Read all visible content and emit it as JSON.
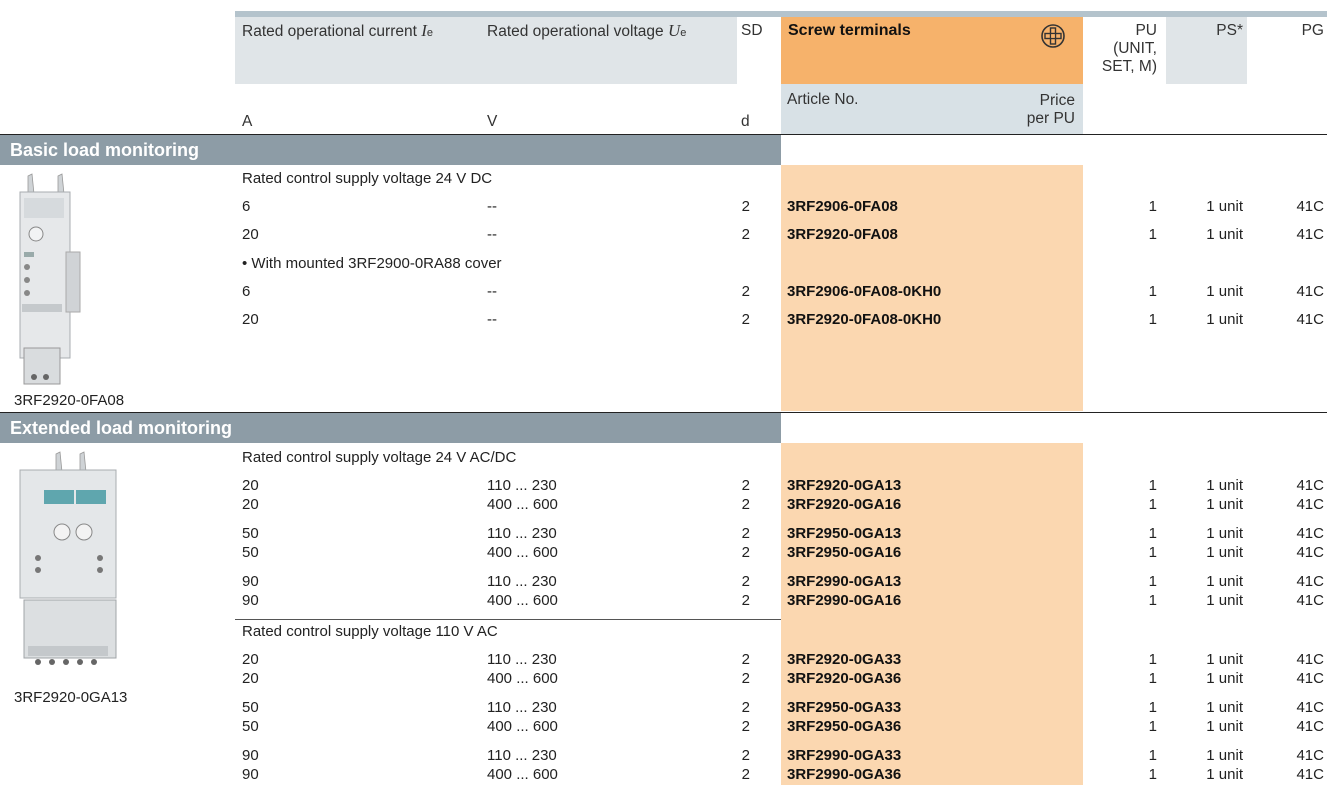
{
  "header": {
    "current_label": "Rated operational current",
    "current_symbol": "I",
    "current_sub": "e",
    "voltage_label": "Rated operational voltage",
    "voltage_symbol": "U",
    "voltage_sub": "e",
    "sd": "SD",
    "screw_terminals": "Screw terminals",
    "pu_line1": "PU",
    "pu_line2": "(UNIT,",
    "pu_line3": "SET, M)",
    "ps": "PS*",
    "pg": "PG",
    "unit_a": "A",
    "unit_v": "V",
    "unit_d": "d",
    "article_no": "Article No.",
    "price_line1": "Price",
    "price_line2": "per PU"
  },
  "basic": {
    "title": "Basic load monitoring",
    "supply": "Rated control supply voltage 24 V DC",
    "cover_note": "• With mounted 3RF2900-0RA88 cover",
    "image_caption": "3RF2920-0FA08",
    "rows": [
      {
        "a": "6",
        "v": "--",
        "sd": "2",
        "art": "3RF2906-0FA08",
        "pu": "1",
        "ps": "1 unit",
        "pg": "41C"
      },
      {
        "a": "20",
        "v": "--",
        "sd": "2",
        "art": "3RF2920-0FA08",
        "pu": "1",
        "ps": "1 unit",
        "pg": "41C"
      },
      {
        "a": "6",
        "v": "--",
        "sd": "2",
        "art": "3RF2906-0FA08-0KH0",
        "pu": "1",
        "ps": "1 unit",
        "pg": "41C"
      },
      {
        "a": "20",
        "v": "--",
        "sd": "2",
        "art": "3RF2920-0FA08-0KH0",
        "pu": "1",
        "ps": "1 unit",
        "pg": "41C"
      }
    ]
  },
  "extended": {
    "title": "Extended load monitoring",
    "supply1": "Rated control supply voltage 24 V AC/DC",
    "supply2": "Rated control supply voltage 110 V AC",
    "image_caption": "3RF2920-0GA13",
    "rows1": [
      {
        "a": "20",
        "v": "110 ... 230",
        "sd": "2",
        "art": "3RF2920-0GA13",
        "pu": "1",
        "ps": "1 unit",
        "pg": "41C"
      },
      {
        "a": "20",
        "v": "400 ... 600",
        "sd": "2",
        "art": "3RF2920-0GA16",
        "pu": "1",
        "ps": "1 unit",
        "pg": "41C"
      },
      {
        "a": "50",
        "v": "110 ... 230",
        "sd": "2",
        "art": "3RF2950-0GA13",
        "pu": "1",
        "ps": "1 unit",
        "pg": "41C"
      },
      {
        "a": "50",
        "v": "400 ... 600",
        "sd": "2",
        "art": "3RF2950-0GA16",
        "pu": "1",
        "ps": "1 unit",
        "pg": "41C"
      },
      {
        "a": "90",
        "v": "110 ... 230",
        "sd": "2",
        "art": "3RF2990-0GA13",
        "pu": "1",
        "ps": "1 unit",
        "pg": "41C"
      },
      {
        "a": "90",
        "v": "400 ... 600",
        "sd": "2",
        "art": "3RF2990-0GA16",
        "pu": "1",
        "ps": "1 unit",
        "pg": "41C"
      }
    ],
    "rows2": [
      {
        "a": "20",
        "v": "110 ... 230",
        "sd": "2",
        "art": "3RF2920-0GA33",
        "pu": "1",
        "ps": "1 unit",
        "pg": "41C"
      },
      {
        "a": "20",
        "v": "400 ... 600",
        "sd": "2",
        "art": "3RF2920-0GA36",
        "pu": "1",
        "ps": "1 unit",
        "pg": "41C"
      },
      {
        "a": "50",
        "v": "110 ... 230",
        "sd": "2",
        "art": "3RF2950-0GA33",
        "pu": "1",
        "ps": "1 unit",
        "pg": "41C"
      },
      {
        "a": "50",
        "v": "400 ... 600",
        "sd": "2",
        "art": "3RF2950-0GA36",
        "pu": "1",
        "ps": "1 unit",
        "pg": "41C"
      },
      {
        "a": "90",
        "v": "110 ... 230",
        "sd": "2",
        "art": "3RF2990-0GA33",
        "pu": "1",
        "ps": "1 unit",
        "pg": "41C"
      },
      {
        "a": "90",
        "v": "400 ... 600",
        "sd": "2",
        "art": "3RF2990-0GA36",
        "pu": "1",
        "ps": "1 unit",
        "pg": "41C"
      }
    ]
  },
  "colors": {
    "orange_header": "#f6b26b",
    "orange_light": "#fbd7b0",
    "section_bar": "#8d9ca6",
    "header_grey": "#e0e5e8",
    "article_header": "#d8e1e6"
  }
}
